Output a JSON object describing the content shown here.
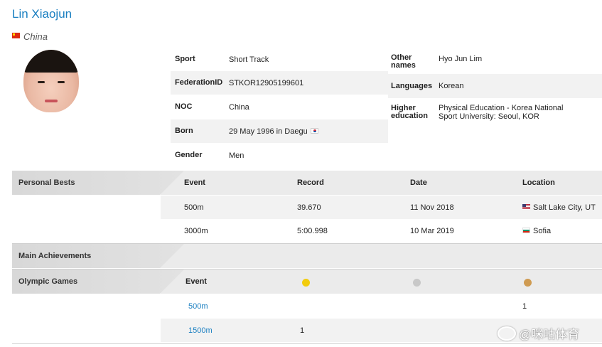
{
  "athlete": {
    "name": "Lin Xiaojun",
    "country": "China"
  },
  "info_left": [
    {
      "label": "Sport",
      "value": "Short Track"
    },
    {
      "label": "FederationID",
      "value": "STKOR12905199601"
    },
    {
      "label": "NOC",
      "value": "China"
    },
    {
      "label": "Born",
      "value": "29 May 1996 in Daegu"
    },
    {
      "label": "Gender",
      "value": "Men"
    }
  ],
  "info_right": [
    {
      "label_line1": "Other",
      "label_line2": "names",
      "value": "Hyo Jun Lim"
    },
    {
      "label_line1": "Languages",
      "label_line2": "",
      "value": "Korean"
    },
    {
      "label_line1": "Higher",
      "label_line2": "education",
      "value_line1": "Physical Education - Korea National",
      "value_line2": "Sport University: Seoul, KOR"
    }
  ],
  "personal_bests": {
    "title": "Personal Bests",
    "headers": [
      "Event",
      "Record",
      "Date",
      "Location"
    ],
    "rows": [
      {
        "event": "500m",
        "record": "39.670",
        "date": "11 Nov 2018",
        "location": "Salt Lake City, UT",
        "flag": "us-flag-icon"
      },
      {
        "event": "3000m",
        "record": "5:00.998",
        "date": "10 Mar 2019",
        "location": "Sofia",
        "flag": "bg-flag-icon"
      }
    ]
  },
  "main_achievements": {
    "title": "Main Achievements"
  },
  "olympic_games": {
    "title": "Olympic Games",
    "header_event": "Event",
    "medal_colors": {
      "gold": "#f2cc0c",
      "silver": "#c8c8c8",
      "bronze": "#cf9b52"
    },
    "rows": [
      {
        "event": "500m",
        "gold": "",
        "silver": "",
        "bronze": "1"
      },
      {
        "event": "1500m",
        "gold": "1",
        "silver": "",
        "bronze": ""
      }
    ]
  },
  "watermark": {
    "text": "@咪咕体育"
  },
  "colors": {
    "link": "#1a7fc1",
    "section_bg": "#ebebeb",
    "row_shade": "#f2f2f2"
  }
}
